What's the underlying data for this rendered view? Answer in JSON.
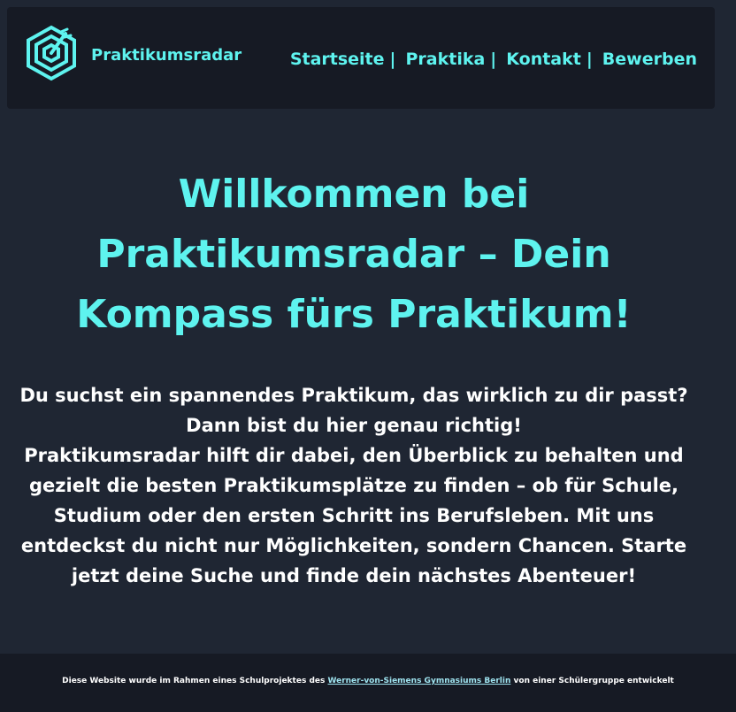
{
  "header": {
    "logo_icon": "target-hexagon-icon",
    "brand": "Praktikumsradar",
    "nav": [
      {
        "label": "Startseite",
        "sep": "|"
      },
      {
        "label": "Praktika",
        "sep": "|"
      },
      {
        "label": "Kontakt",
        "sep": "|"
      },
      {
        "label": "Bewerben",
        "sep": ""
      }
    ]
  },
  "hero": {
    "title": "Willkommen bei Praktikumsradar – Dein Kompass fürs Praktikum!",
    "intro_lines": [
      "Du suchst ein spannendes Praktikum, das wirklich zu dir passt?",
      "Dann bist du hier genau richtig!",
      "Praktikumsradar hilft dir dabei, den Überblick zu behalten und gezielt die besten Praktikumsplätze zu finden – ob für Schule, Studium oder den ersten Schritt ins Berufsleben. Mit uns entdeckst du nicht nur Möglichkeiten, sondern Chancen. Starte jetzt deine Suche und finde dein nächstes Abenteuer!"
    ]
  },
  "footer": {
    "prefix": "Diese Website wurde im Rahmen eines Schulprojektes des",
    "link": "Werner-von-Siemens Gymnasiums Berlin",
    "suffix": "von einer Schülergruppe entwickelt"
  },
  "colors": {
    "accent": "#5ef3ef",
    "background": "#1f2633",
    "panel": "#161a24",
    "text": "#ffffff"
  }
}
